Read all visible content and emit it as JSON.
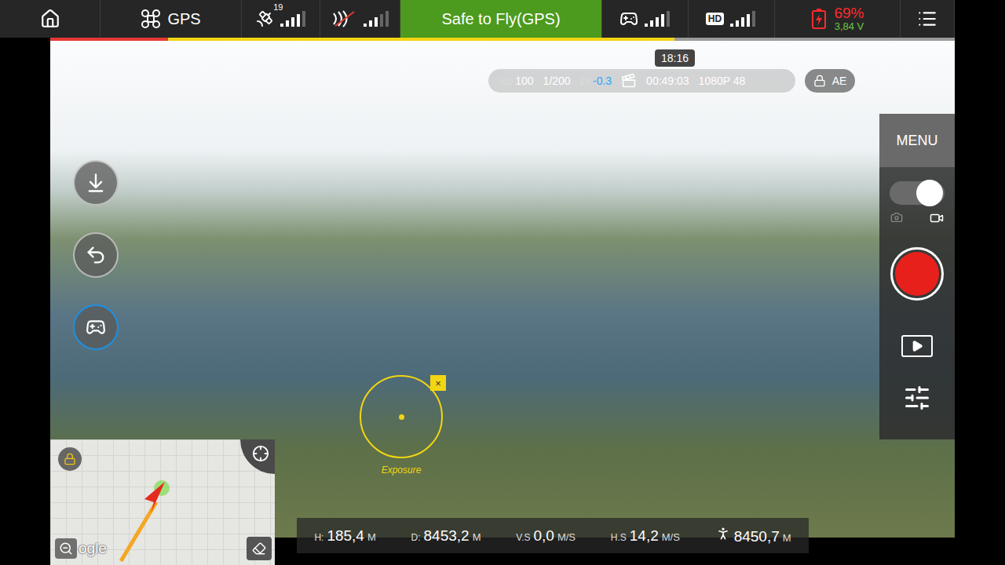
{
  "top_bar": {
    "mode": "GPS",
    "satellites": "19",
    "satellite_level": 0.8,
    "video_link_level": 0.6,
    "status": "Safe to Fly(GPS)",
    "rc_level": 0.8,
    "hd_label": "HD",
    "hd_level": 0.8,
    "battery_percent": "69%",
    "battery_voltage": "3,84 V"
  },
  "flight_progress": {
    "red_level": 0.13,
    "level": 0.69,
    "tooltip": "18:16"
  },
  "camera": {
    "iso_label": "ISO",
    "iso": "100",
    "shutter": "1/200",
    "ev_label": "EV",
    "ev": "-0.3",
    "record_time": "00:49:03",
    "resolution": "1080P 48"
  },
  "ae_lock": {
    "label": "AE",
    "locked": true
  },
  "left_buttons": [
    {
      "kind": "takeoff",
      "selected": false
    },
    {
      "kind": "return-home",
      "selected": false
    },
    {
      "kind": "remote",
      "selected": true
    }
  ],
  "exposure": {
    "label": "Exposure",
    "close": "×"
  },
  "side_panel": {
    "menu": "MENU",
    "photo_selected": false,
    "video_selected": true,
    "recording": false
  },
  "map": {
    "locked": true,
    "logo": "ogle"
  },
  "telemetry": [
    {
      "kind": "text",
      "label": "H:",
      "value": "185,4",
      "unit": "M"
    },
    {
      "kind": "text",
      "label": "D:",
      "value": "8453,2",
      "unit": "M"
    },
    {
      "kind": "text",
      "label": "V.S",
      "value": "0,0",
      "unit": "M/S"
    },
    {
      "kind": "text",
      "label": "H.S",
      "value": "14,2",
      "unit": "M/S"
    },
    {
      "kind": "icon",
      "value": "8450,7",
      "unit": "M"
    }
  ]
}
